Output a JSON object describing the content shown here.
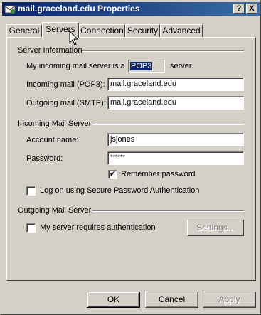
{
  "window": {
    "title": "mail.graceland.edu Properties",
    "help_label": "?",
    "close_label": "X"
  },
  "tabs": [
    {
      "label": "General"
    },
    {
      "label": "Servers"
    },
    {
      "label": "Connection"
    },
    {
      "label": "Security"
    },
    {
      "label": "Advanced"
    }
  ],
  "server_info": {
    "group_label": "Server Information",
    "incoming_prefix": "My incoming mail server is a",
    "incoming_type": "POP3",
    "incoming_suffix": "server.",
    "pop3_label": "Incoming mail (POP3):",
    "pop3_value": "mail.graceland.edu",
    "smtp_label": "Outgoing mail (SMTP):",
    "smtp_value": "mail.graceland.edu"
  },
  "incoming": {
    "group_label": "Incoming Mail Server",
    "account_label": "Account name:",
    "account_value": "jsjones",
    "password_label": "Password:",
    "password_value": "******",
    "remember_label": "Remember password",
    "remember_checked": true,
    "spa_label": "Log on using Secure Password Authentication",
    "spa_checked": false
  },
  "outgoing": {
    "group_label": "Outgoing Mail Server",
    "auth_label": "My server requires authentication",
    "auth_checked": false,
    "settings_label": "Settings..."
  },
  "footer": {
    "ok_label": "OK",
    "cancel_label": "Cancel",
    "apply_label": "Apply"
  }
}
